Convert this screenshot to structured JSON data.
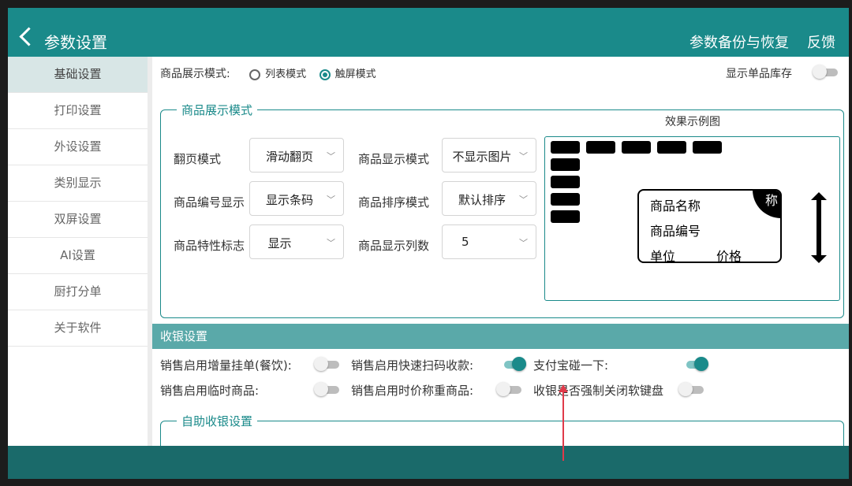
{
  "header": {
    "title": "参数设置",
    "backup_label": "参数备份与恢复",
    "feedback_label": "反馈"
  },
  "sidebar": {
    "items": [
      {
        "label": "基础设置",
        "active": true
      },
      {
        "label": "打印设置"
      },
      {
        "label": "外设设置"
      },
      {
        "label": "类别显示"
      },
      {
        "label": "双屏设置"
      },
      {
        "label": "AI设置"
      },
      {
        "label": "厨打分单"
      },
      {
        "label": "关于软件"
      }
    ]
  },
  "display_mode": {
    "label": "商品展示模式:",
    "options": [
      "列表模式",
      "触屏模式"
    ],
    "selected": "触屏模式",
    "show_stock_label": "显示单品库存",
    "show_stock_on": false
  },
  "product_display": {
    "legend": "商品展示模式",
    "fields": [
      {
        "label": "翻页模式",
        "value": "滑动翻页"
      },
      {
        "label": "商品显示模式",
        "value": "不显示图片"
      },
      {
        "label": "商品编号显示",
        "value": "显示条码"
      },
      {
        "label": "商品排序模式",
        "value": "默认排序"
      },
      {
        "label": "商品特性标志",
        "value": "显示"
      },
      {
        "label": "商品显示列数",
        "value": "5"
      }
    ],
    "preview_title": "效果示例图",
    "preview_card": {
      "name": "商品名称",
      "code": "商品编号",
      "unit": "单位",
      "price": "价格",
      "corner": "称"
    }
  },
  "cashier": {
    "section_title": "收银设置",
    "options": [
      {
        "label": "销售启用增量挂单(餐饮):",
        "on": false
      },
      {
        "label": "销售启用快速扫码收款:",
        "on": true
      },
      {
        "label": "支付宝碰一下:",
        "on": true
      },
      {
        "label": "销售启用临时商品:",
        "on": false
      },
      {
        "label": "销售启用时价称重商品:",
        "on": false
      },
      {
        "label": "收银是否强制关闭软键盘",
        "on": false
      }
    ]
  },
  "self_checkout": {
    "legend": "自助收银设置"
  },
  "colors": {
    "primary": "#1a8a8a",
    "section": "#5aa9a9",
    "bottom_bar": "#1a6a6a",
    "annotation": "#e03a4a"
  }
}
